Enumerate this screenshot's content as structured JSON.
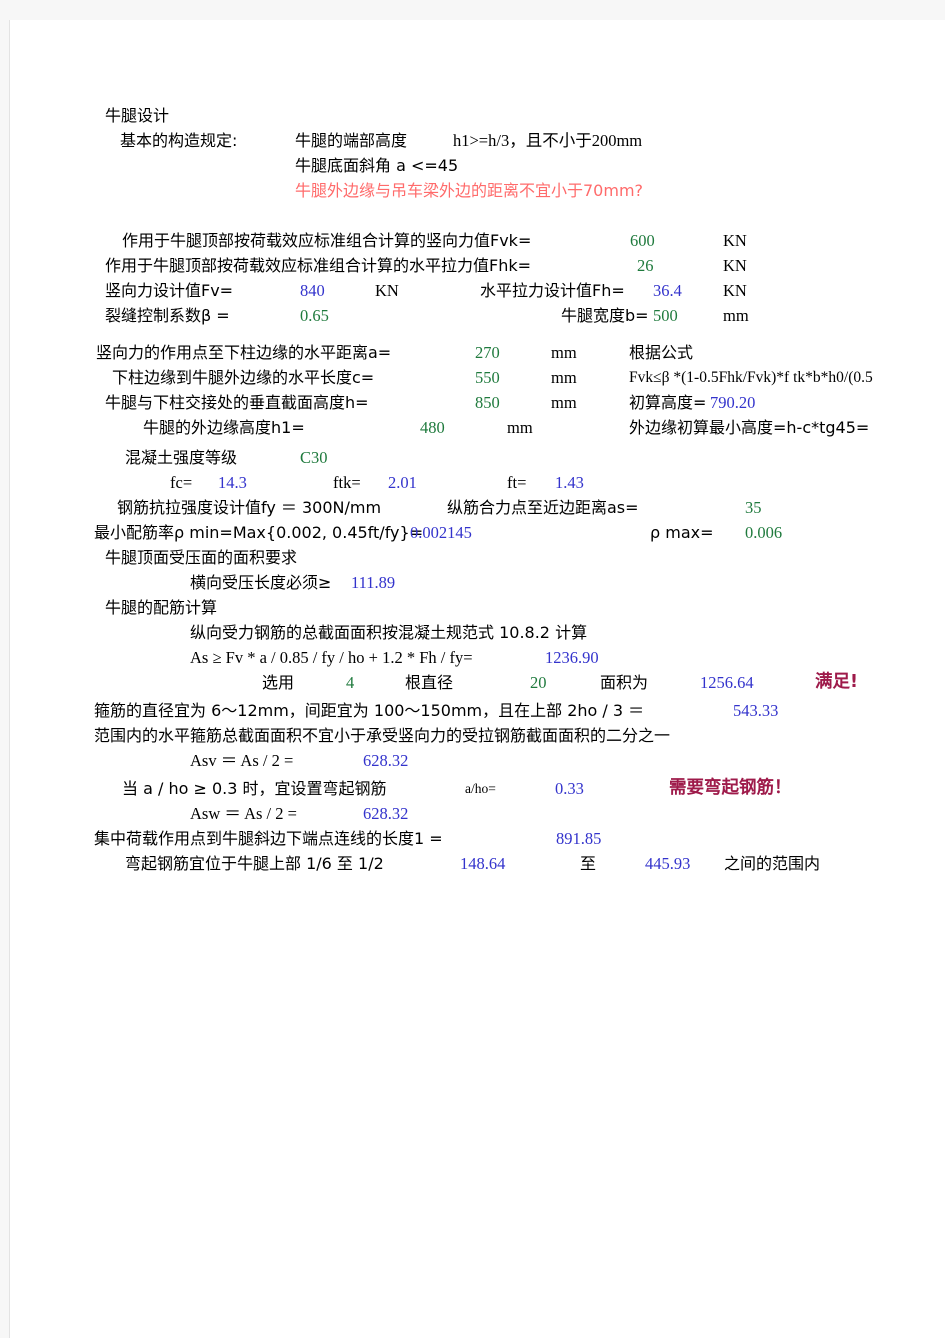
{
  "document": {
    "title": "牛腿设计",
    "section_heading": "基本的构造规定:",
    "rules": {
      "rule1": "牛腿的端部高度",
      "rule1_formula": "h1>=h/3，且不小于200mm",
      "rule2": "牛腿底面斜角 a <=45",
      "rule3_warning": "牛腿外边缘与吊车梁外边的距离不宜小于70mm?"
    },
    "loads": {
      "fvk_label": "作用于牛腿顶部按荷载效应标准组合计算的竖向力值Fvk=",
      "fvk_value": "600",
      "fvk_unit": "KN",
      "fhk_label": "作用于牛腿顶部按荷载效应标准组合计算的水平拉力值Fhk=",
      "fhk_value": "26",
      "fhk_unit": "KN",
      "fv_label": "竖向力设计值Fv=",
      "fv_value": "840",
      "fv_unit": "KN",
      "fh_label": "水平拉力设计值Fh=",
      "fh_value": "36.4",
      "fh_unit": "KN",
      "beta_label": "裂缝控制系数β =",
      "beta_value": "0.65",
      "b_label": "牛腿宽度b=",
      "b_value": "500",
      "b_unit": "mm"
    },
    "geometry": {
      "a_label": "竖向力的作用点至下柱边缘的水平距离a=",
      "a_value": "270",
      "a_unit": "mm",
      "c_label": "下柱边缘到牛腿外边缘的水平长度c=",
      "c_value": "550",
      "c_unit": "mm",
      "h_label": "牛腿与下柱交接处的垂直截面高度h=",
      "h_value": "850",
      "h_unit": "mm",
      "h1_label": "牛腿的外边缘高度h1=",
      "h1_value": "480",
      "h1_unit": "mm"
    },
    "formula_panel": {
      "heading": "根据公式",
      "formula": "Fvk≤β *(1-0.5Fhk/Fvk)*f tk*b*h0/(0.5",
      "calc_height_label": "初算高度=",
      "calc_height_value": "790.20",
      "min_edge_height_label": "外边缘初算最小高度=h-c*tg45="
    },
    "material": {
      "grade_label": "混凝土强度等级",
      "grade_value": "C30",
      "fc_label": "fc=",
      "fc_value": "14.3",
      "ftk_label": "ftk=",
      "ftk_value": "2.01",
      "ft_label": "ft=",
      "ft_value": "1.43",
      "fy_label": "钢筋抗拉强度设计值fy ＝ 300N/mm",
      "as_label": "纵筋合力点至近边距离as=",
      "as_value": "35",
      "rho_min_label": "最小配筋率ρ min=Max{0.002, 0.45ft/fy}=",
      "rho_min_value": "0.002145",
      "rho_max_label": "ρ max=",
      "rho_max_value": "0.006"
    },
    "bearing": {
      "heading": "牛腿顶面受压面的面积要求",
      "length_label": "横向受压长度必须≥",
      "length_value": "111.89"
    },
    "reinforcement": {
      "heading": "牛腿的配筋计算",
      "code_note": "纵向受力钢筋的总截面面积按混凝土规范式 10.8.2 计算",
      "as_formula_label": "As ≥ Fv * a / 0.85 / fy / ho + 1.2 * Fh / fy=",
      "as_formula_value": "1236.90",
      "select_label": "选用",
      "select_count": "4",
      "bar_label": "根直径",
      "bar_diameter": "20",
      "area_label": "面积为",
      "area_value": "1256.64",
      "status": "满足!"
    },
    "stirrups": {
      "line1_a": "箍筋的直径宜为 6～12mm，间距宜为 100～150mm，且在上部 2ho / 3 ＝",
      "line1_value": "543.33",
      "line2": "范围内的水平箍筋总截面面积不宜小于承受竖向力的受拉钢筋截面面积的二分之一",
      "asv_label": "Asv ＝ As / 2 =",
      "asv_value": "628.32"
    },
    "bent_bars": {
      "condition_label": "当 a / ho ≥ 0.3 时，宜设置弯起钢筋",
      "ratio_label": "a/ho=",
      "ratio_value": "0.33",
      "status": "需要弯起钢筋！",
      "asw_label": "Asw ＝ As / 2 =",
      "asw_value": "628.32",
      "length_label": "集中荷载作用点到牛腿斜边下端点连线的长度1 =",
      "length_value": "891.85",
      "range_label": "弯起钢筋宜位于牛腿上部 1/6 至 1/2",
      "range_from": "148.64",
      "range_to_label": "至",
      "range_to": "445.93",
      "range_suffix": "之间的范围内"
    }
  },
  "colors": {
    "input_green": "#1f7a3d",
    "computed_blue": "#3333cc",
    "warning_red": "#ff6b6b",
    "status_maroon": "#9e1a4a"
  }
}
